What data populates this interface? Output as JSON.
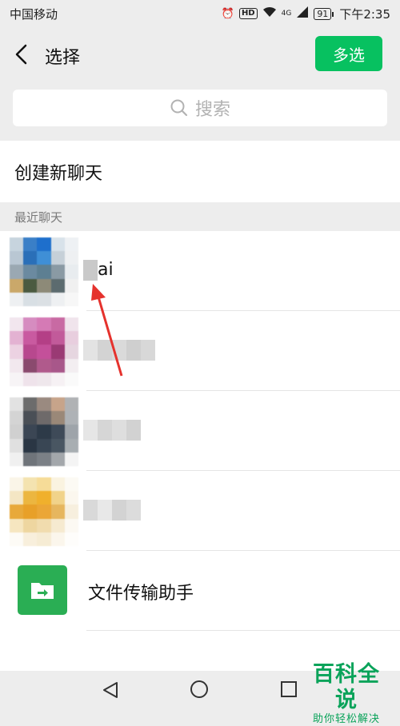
{
  "status_bar": {
    "carrier": "中国移动",
    "alarm_icon": "alarm-icon",
    "hd_label": "HD",
    "wifi_icon": "wifi-icon",
    "signal_label": "4G",
    "battery": "91",
    "time": "下午2:35"
  },
  "header": {
    "title": "选择",
    "multi_select_label": "多选",
    "accent_color": "#07c160"
  },
  "search": {
    "placeholder": "搜索"
  },
  "create_chat_label": "创建新聊天",
  "recent_header": "最近聊天",
  "contacts": [
    {
      "name": "ai",
      "name_visible_fragment": "ai",
      "blurred": true
    },
    {
      "name": "",
      "blurred": true
    },
    {
      "name": "",
      "blurred": true
    },
    {
      "name": "",
      "blurred": true
    },
    {
      "name": "文件传输助手",
      "blurred": false,
      "icon": "folder-arrow-icon"
    }
  ],
  "watermark": {
    "main": "百科全说",
    "sub": "助你轻松解决"
  }
}
